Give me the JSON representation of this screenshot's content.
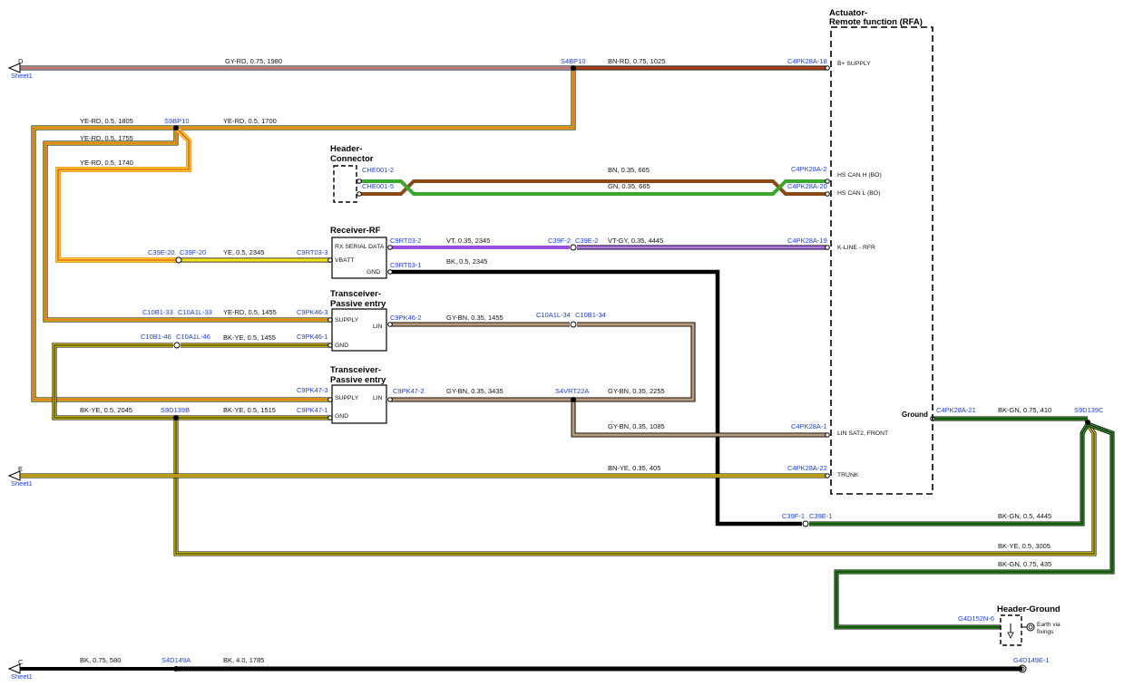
{
  "wires": {
    "w_d_left": "GY-RD, 0.75, 1980",
    "w_bn_rd": "BN-RD, 0.75, 1025",
    "w_yerd_1805": "YE-RD, 0.5, 1805",
    "w_yerd_1700": "YE-RD, 0.5, 1700",
    "w_yerd_1755": "YE-RD, 0.5, 1755",
    "w_yerd_1740": "YE-RD, 0.5, 1740",
    "w_bn_665": "BN, 0.35, 665",
    "w_gn_665": "GN, 0.35, 665",
    "w_ye_2345": "YE, 0.5, 2345",
    "w_vt_2345": "VT, 0.35, 2345",
    "w_vtgy_4445": "VT-GY, 0.35, 4445",
    "w_bk_2345": "BK, 0.5, 2345",
    "w_yerd_1455": "YE-RD, 0.5, 1455",
    "w_gybn_1455": "GY-BN, 0.35, 1455",
    "w_bkye_1455": "BK-YE, 0.5, 1455",
    "w_gybn_3435": "GY-BN, 0.35, 3435",
    "w_gybn_2255": "GY-BN, 0.35, 2255",
    "w_bkye_2045": "BK-YE, 0.5, 2045",
    "w_bkye_1515": "BK-YE, 0.5, 1515",
    "w_gybn_1085": "GY-BN, 0.35, 1085",
    "w_bkgn_410": "BK-GN, 0.75, 410",
    "w_bnye_405": "BN-YE, 0.35, 405",
    "w_bkgn_4445": "BK-GN, 0.5, 4445",
    "w_bkye_3005": "BK-YE, 0.5, 3005",
    "w_bkgn_435": "BK-GN, 0.75, 435",
    "w_bk_580": "BK, 0.75, 580",
    "w_bk_1785": "BK, 4.0, 1785"
  },
  "connectors": {
    "s4bp10": "S4BP10",
    "c4pk28a_18": "C4PK28A-18",
    "s9bp10": "S9BP10",
    "che001_2": "CHE001-2",
    "che001_5": "CHE001-5",
    "c4pk28a_2": "C4PK28A-2",
    "c4pk28a_20": "C4PK28A-20",
    "c39e_20": "C39E-20",
    "c39f_20": "C39F-20",
    "c9rt03_3": "C9RT03-3",
    "c9rt03_2": "C9RT03-2",
    "c9rt03_1": "C9RT03-1",
    "c39f_2": "C39F-2",
    "c39e_2": "C39E-2",
    "c4pk28a_19": "C4PK28A-19",
    "c10b1_33": "C10B1-33",
    "c10a1l_33": "C10A1L-33",
    "c9pk46_3": "C9PK46-3",
    "c9pk46_2": "C9PK46-2",
    "c10a1l_34": "C10A1L-34",
    "c10b1_34": "C10B1-34",
    "c10b1_46": "C10B1-46",
    "c10a1l_46": "C10A1L-46",
    "c9pk46_1": "C9PK46-1",
    "c9pk47_3": "C9PK47-3",
    "c9pk47_2": "C9PK47-2",
    "s4vrt22a": "S4VRT22A",
    "s9d139b": "S9D139B",
    "c9pk47_1": "C9PK47-1",
    "c4pk28a_1": "C4PK28A-1",
    "c4pk28a_21": "C4PK28A-21",
    "s9d139c": "S9D139C",
    "c4pk28a_22": "C4PK28A-22",
    "c39f_1": "C39F-1",
    "c39e_1": "C39E-1",
    "g4d152n_6": "G4D152N-6",
    "s4d149a": "S4D149A",
    "g4d149e_1": "G4D149E-1"
  },
  "sheet_refs": {
    "d_letter": "D",
    "e_letter": "E",
    "c_letter": "C",
    "sheet_label": "Sheet1"
  },
  "components": {
    "rfa_title_1": "Actuator-",
    "rfa_title_2": "Remote function (RFA)",
    "rfa_pin_bplus": "B+ SUPPLY",
    "rfa_pin_canh": "HS CAN H (BO)",
    "rfa_pin_canl": "HS CAN L (BO)",
    "rfa_pin_kline": "K-LINE - RFR",
    "rfa_pin_lin": "LIN SAT2, FRONT",
    "rfa_pin_trunk": "TRUNK",
    "rfa_pin_ground": "Ground",
    "hdr_title_1": "Header-",
    "hdr_title_2": "Connector",
    "rx_title": "Receiver-RF",
    "rx_pin_serial": "RX SERIAL DATA",
    "rx_pin_vbatt": "VBATT",
    "rx_pin_gnd": "GND",
    "tx1_title_1": "Transceiver-",
    "tx1_title_2": "Passive entry",
    "tx1_pin_supply": "SUPPLY",
    "tx1_pin_lin": "LIN",
    "tx1_pin_gnd": "GND",
    "tx2_title_1": "Transceiver-",
    "tx2_title_2": "Passive entry",
    "tx2_pin_supply": "SUPPLY",
    "tx2_pin_lin": "LIN",
    "tx2_pin_gnd": "GND",
    "hg_title": "Header-Ground",
    "hg_text_1": "Earth via",
    "hg_text_2": "fixings"
  },
  "colors": {
    "gray": "#b8b8b8",
    "red": "#e0262a",
    "brown": "#8a4a18",
    "yellow": "#f4e21c",
    "green": "#3aa62c",
    "violet": "#9a4de0",
    "black": "#000000",
    "connector_blue": "#1f3fd6"
  }
}
